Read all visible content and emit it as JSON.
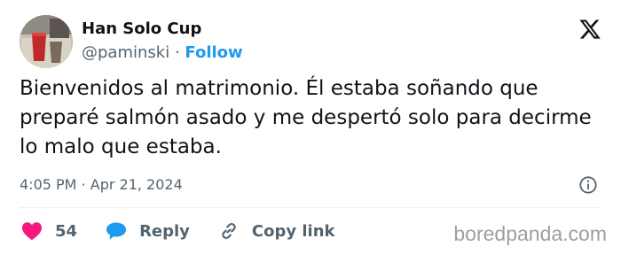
{
  "tweet": {
    "display_name": "Han Solo Cup",
    "handle": "@paminski",
    "separator": "·",
    "follow_label": "Follow",
    "text": "Bienvenidos al matrimonio. Él estaba soñando que preparé salmón asado y me despertó solo para de­cirme lo malo que estaba.",
    "time": "4:05 PM",
    "date_separator": "·",
    "date": "Apr 21, 2024"
  },
  "actions": {
    "like_count": "54",
    "reply_label": "Reply",
    "copy_link_label": "Copy link"
  },
  "icons": {
    "brand": "x-logo-icon",
    "info": "info-icon",
    "like": "heart-icon",
    "reply": "speech-bubble-icon",
    "link": "link-icon"
  },
  "colors": {
    "like": "#f91880",
    "reply": "#1d9bf0",
    "follow": "#1d9bf0",
    "muted": "#536471",
    "text": "#0f1419"
  },
  "watermark": "boredpanda.com"
}
